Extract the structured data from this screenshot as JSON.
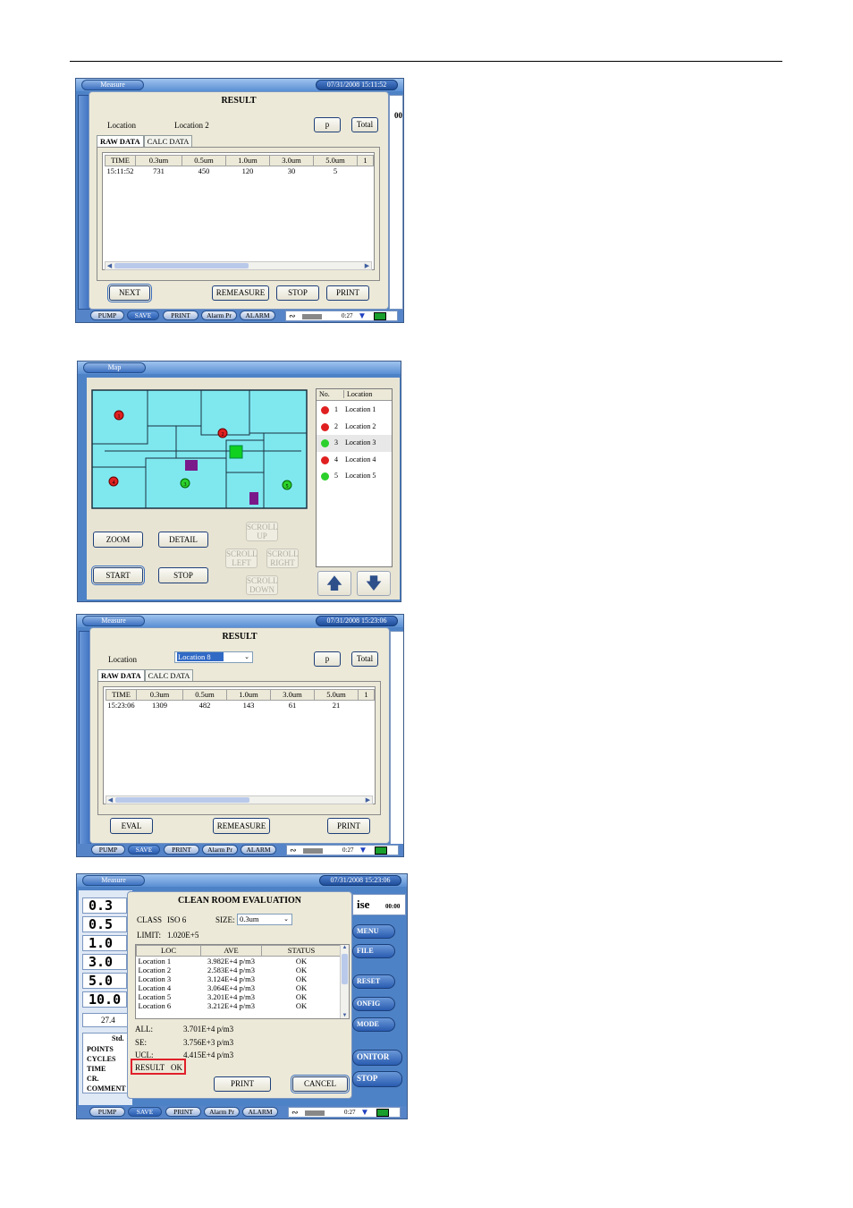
{
  "screen1": {
    "window_title": "Measure",
    "clock": "07/31/2008 15:11:52",
    "dialog_title": "RESULT",
    "location_label": "Location",
    "location_value": "Location 2",
    "p_button": "p",
    "total_button": "Total",
    "tabs": [
      "RAW DATA",
      "CALC DATA"
    ],
    "columns": [
      "TIME",
      "0.3um",
      "0.5um",
      "1.0um",
      "3.0um",
      "5.0um",
      "1"
    ],
    "rows": [
      [
        "15:11:52",
        "731",
        "450",
        "120",
        "30",
        "5",
        ""
      ]
    ],
    "buttons": {
      "next": "NEXT",
      "remeasure": "REMEASURE",
      "stop": "STOP",
      "print": "PRINT"
    },
    "side_value": "00",
    "bottom": [
      "PUMP",
      "SAVE",
      "PRINT",
      "Alarm Pr",
      "ALARM"
    ],
    "status_value": "0:27"
  },
  "screen2": {
    "window_title": "Map",
    "list_header": [
      "No.",
      "Location"
    ],
    "locations": [
      {
        "no": "1",
        "name": "Location 1",
        "color": "#e02020"
      },
      {
        "no": "2",
        "name": "Location 2",
        "color": "#e02020"
      },
      {
        "no": "3",
        "name": "Location 3",
        "color": "#2cd02c"
      },
      {
        "no": "4",
        "name": "Location 4",
        "color": "#e02020"
      },
      {
        "no": "5",
        "name": "Location 5",
        "color": "#2cd02c"
      }
    ],
    "markers": [
      "1",
      "2",
      "3",
      "4",
      "5"
    ],
    "buttons": {
      "zoom": "ZOOM",
      "detail": "DETAIL",
      "start": "START",
      "stop": "STOP",
      "scroll_up_1": "SCROLL",
      "scroll_up_2": "UP",
      "scroll_left_1": "SCROLL",
      "scroll_left_2": "LEFT",
      "scroll_right_1": "SCROLL",
      "scroll_right_2": "RIGHT",
      "scroll_down_1": "SCROLL",
      "scroll_down_2": "DOWN"
    }
  },
  "screen3": {
    "window_title": "Measure",
    "clock": "07/31/2008 15:23:06",
    "dialog_title": "RESULT",
    "location_label": "Location",
    "location_value": "Location 8",
    "p_button": "p",
    "total_button": "Total",
    "tabs": [
      "RAW DATA",
      "CALC DATA"
    ],
    "columns": [
      "TIME",
      "0.3um",
      "0.5um",
      "1.0um",
      "3.0um",
      "5.0um",
      "1"
    ],
    "rows": [
      [
        "15:23:06",
        "1309",
        "482",
        "143",
        "61",
        "21",
        ""
      ]
    ],
    "buttons": {
      "eval": "EVAL",
      "remeasure": "REMEASURE",
      "print": "PRINT"
    },
    "bottom": [
      "PUMP",
      "SAVE",
      "PRINT",
      "Alarm Pr",
      "ALARM"
    ],
    "status_value": "0:27"
  },
  "screen4": {
    "window_title": "Measure",
    "clock": "07/31/2008 15:23:06",
    "dialog_title": "CLEAN ROOM EVALUATION",
    "class_label": "CLASS",
    "class_value": "ISO 6",
    "size_label": "SIZE:",
    "size_value": "0.3um",
    "limit_label": "LIMIT:",
    "limit_value": "1.020E+5",
    "columns": [
      "LOC",
      "AVE",
      "STATUS"
    ],
    "rows": [
      [
        "Location 1",
        "3.982E+4 p/m3",
        "OK"
      ],
      [
        "Location 2",
        "2.583E+4 p/m3",
        "OK"
      ],
      [
        "Location 3",
        "3.124E+4 p/m3",
        "OK"
      ],
      [
        "Location 4",
        "3.064E+4 p/m3",
        "OK"
      ],
      [
        "Location 5",
        "3.201E+4 p/m3",
        "OK"
      ],
      [
        "Location 6",
        "3.212E+4 p/m3",
        "OK"
      ]
    ],
    "all_label": "ALL:",
    "all_value": "3.701E+4 p/m3",
    "se_label": "SE:",
    "se_value": "3.756E+3 p/m3",
    "ucl_label": "UCL:",
    "ucl_value": "4.415E+4 p/m3",
    "result_label": "RESULT",
    "result_value": "OK",
    "buttons": {
      "print": "PRINT",
      "cancel": "CANCEL"
    },
    "big_values": [
      "0.3",
      "0.5",
      "1.0",
      "3.0",
      "5.0",
      "10.0"
    ],
    "temp": "27.4",
    "std_label": "Std.",
    "info_labels": [
      "POINTS",
      "CYCLES",
      "TIME",
      "CR.",
      "COMMENT"
    ],
    "right_side_text": "ise",
    "right_side_value": "00:00",
    "right_buttons": [
      "MENU",
      "FILE",
      "RESET",
      "ONFIG",
      "MODE"
    ],
    "monitor": "ONITOR",
    "stop": "STOP",
    "bottom": [
      "PUMP",
      "SAVE",
      "PRINT",
      "Alarm Pr",
      "ALARM"
    ],
    "status_value": "0:27"
  }
}
